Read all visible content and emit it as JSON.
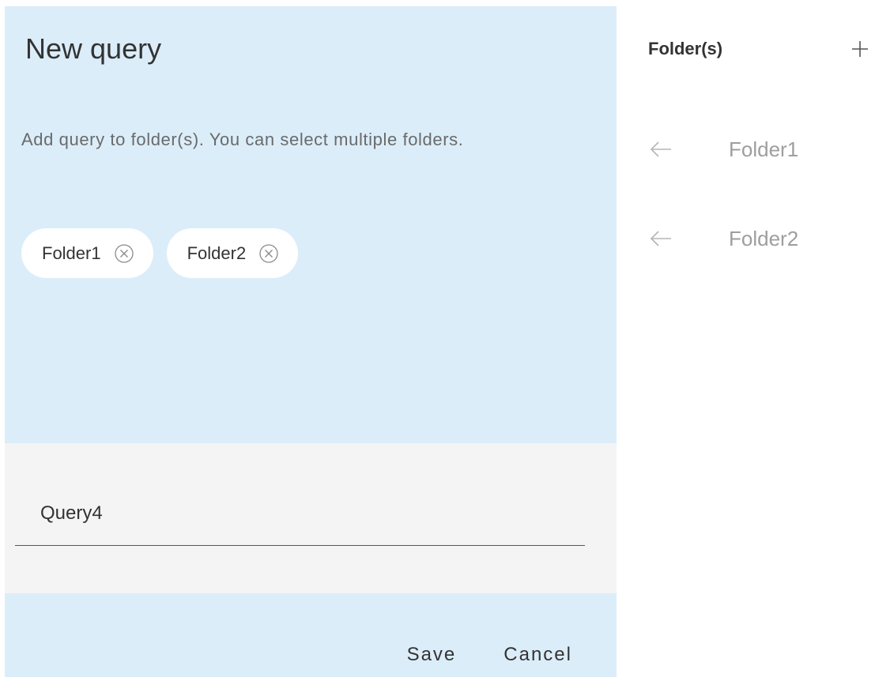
{
  "dialog": {
    "title": "New query",
    "hint": "Add query to folder(s). You can select multiple folders.",
    "chips": [
      {
        "label": "Folder1"
      },
      {
        "label": "Folder2"
      }
    ],
    "query_name": {
      "value": "Query4",
      "placeholder": ""
    },
    "save_label": "Save",
    "cancel_label": "Cancel"
  },
  "folders_panel": {
    "heading": "Folder(s)",
    "items": [
      {
        "label": "Folder1",
        "icon": "arrow-left-icon"
      },
      {
        "label": "Folder2",
        "icon": "arrow-left-icon"
      }
    ],
    "add_icon": "plus-icon"
  },
  "colors": {
    "panel_bg": "#dbedf9",
    "input_section_bg": "#f4f4f4",
    "text_primary": "#333333",
    "text_muted": "#6a6a6a",
    "folder_text": "#9e9e9e"
  }
}
